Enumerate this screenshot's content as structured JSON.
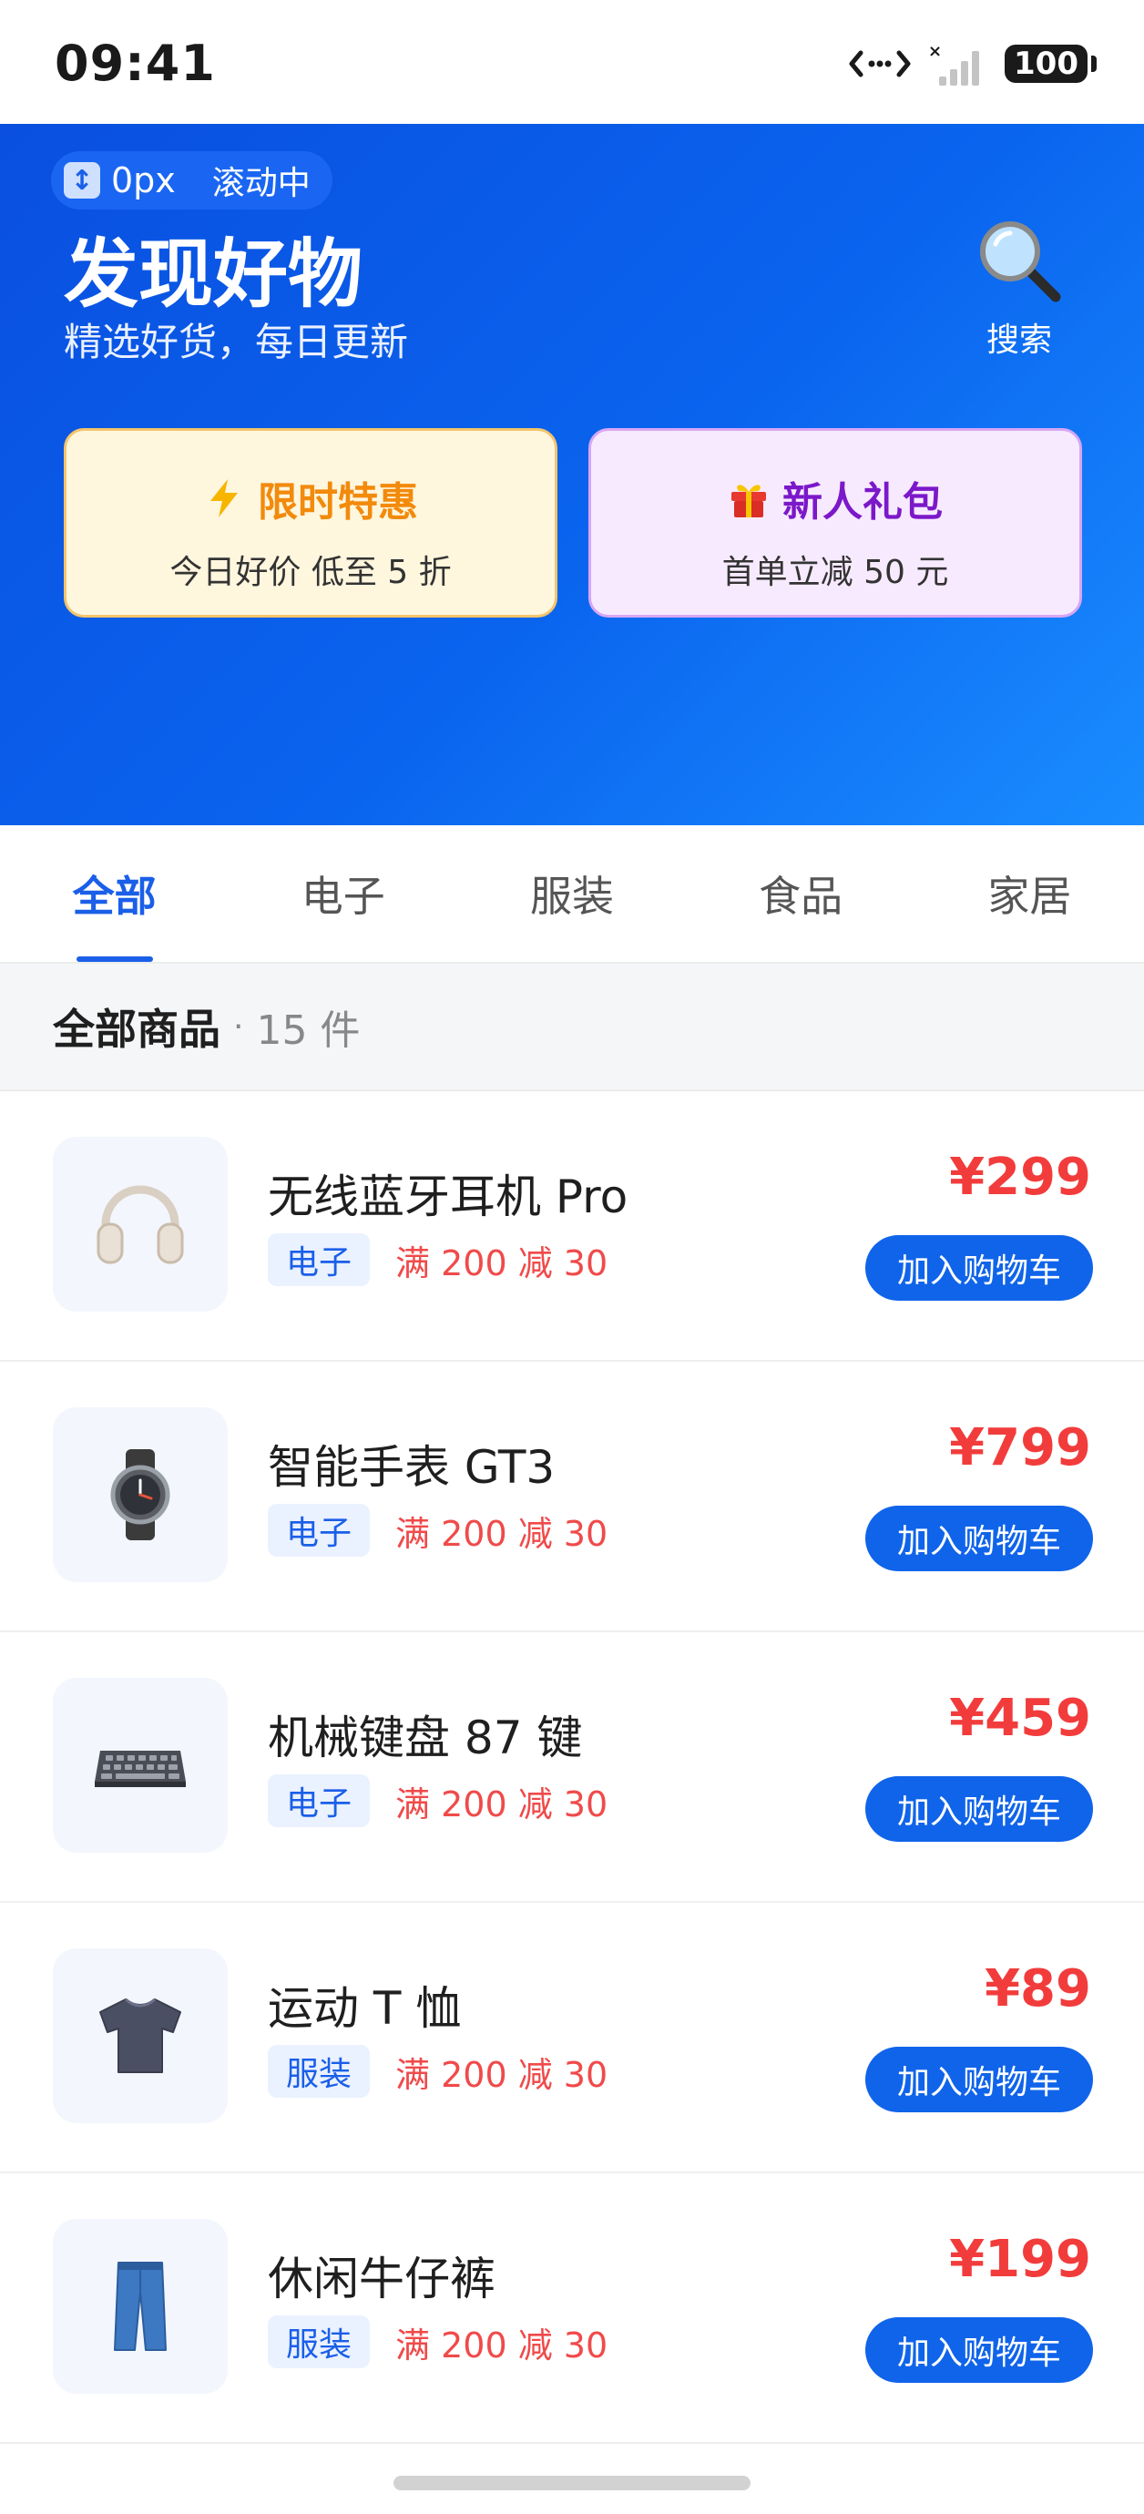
{
  "status_bar": {
    "time": "09:41",
    "battery": "100",
    "icons": [
      "network-icon",
      "signal-icon",
      "battery-icon"
    ]
  },
  "hero": {
    "scroll_offset": "0px",
    "scroll_state": "滚动中",
    "title": "发现好物",
    "subtitle": "精选好货，每日更新",
    "search_label": "搜索",
    "promos": [
      {
        "icon": "lightning-icon",
        "title": "限时特惠",
        "desc": "今日好价 低至 5 折"
      },
      {
        "icon": "gift-icon",
        "title": "新人礼包",
        "desc": "首单立减 50 元"
      }
    ]
  },
  "tabs": [
    "全部",
    "电子",
    "服装",
    "食品",
    "家居"
  ],
  "active_tab": "全部",
  "section": {
    "title": "全部商品",
    "separator": "·",
    "count": "15 件"
  },
  "products": [
    {
      "name": "无线蓝牙耳机 Pro",
      "category": "电子",
      "promo": "满 200 减 30",
      "price": "¥299",
      "cart": "加入购物车",
      "icon": "headphones-icon"
    },
    {
      "name": "智能手表 GT3",
      "category": "电子",
      "promo": "满 200 减 30",
      "price": "¥799",
      "cart": "加入购物车",
      "icon": "watch-icon"
    },
    {
      "name": "机械键盘 87 键",
      "category": "电子",
      "promo": "满 200 减 30",
      "price": "¥459",
      "cart": "加入购物车",
      "icon": "keyboard-icon"
    },
    {
      "name": "运动 T 恤",
      "category": "服装",
      "promo": "满 200 减 30",
      "price": "¥89",
      "cart": "加入购物车",
      "icon": "tshirt-icon"
    },
    {
      "name": "休闲牛仔裤",
      "category": "服装",
      "promo": "满 200 减 30",
      "price": "¥199",
      "cart": "加入购物车",
      "icon": "jeans-icon"
    }
  ],
  "colors": {
    "primary": "#1064ea",
    "price": "#f23c3c",
    "hero_start": "#0a4fe0",
    "hero_end": "#1a8cff"
  }
}
